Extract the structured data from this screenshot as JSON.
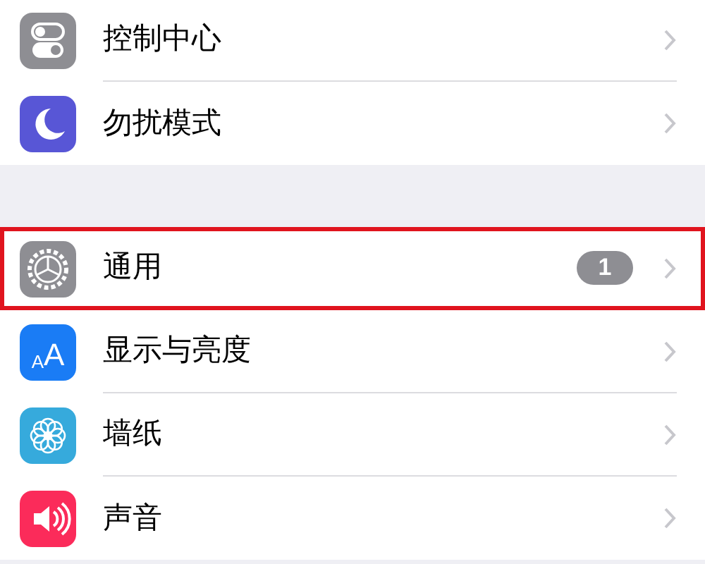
{
  "groups": [
    {
      "items": [
        {
          "label": "控制中心",
          "kind": "switches",
          "color": "#8e8e93",
          "highlighted": false
        },
        {
          "label": "勿扰模式",
          "kind": "moon",
          "color": "#5856d6",
          "highlighted": false
        }
      ]
    },
    {
      "items": [
        {
          "label": "通用",
          "kind": "gear",
          "color": "#8e8e93",
          "badge": "1",
          "highlighted": true
        },
        {
          "label": "显示与亮度",
          "kind": "letters",
          "icon_text": "AA",
          "color": "#1a7cf5",
          "highlighted": false
        },
        {
          "label": "墙纸",
          "kind": "flower",
          "color": "#36aadc",
          "highlighted": false
        },
        {
          "label": "声音",
          "kind": "speaker",
          "color": "#fb2b5a",
          "highlighted": false
        }
      ]
    }
  ]
}
